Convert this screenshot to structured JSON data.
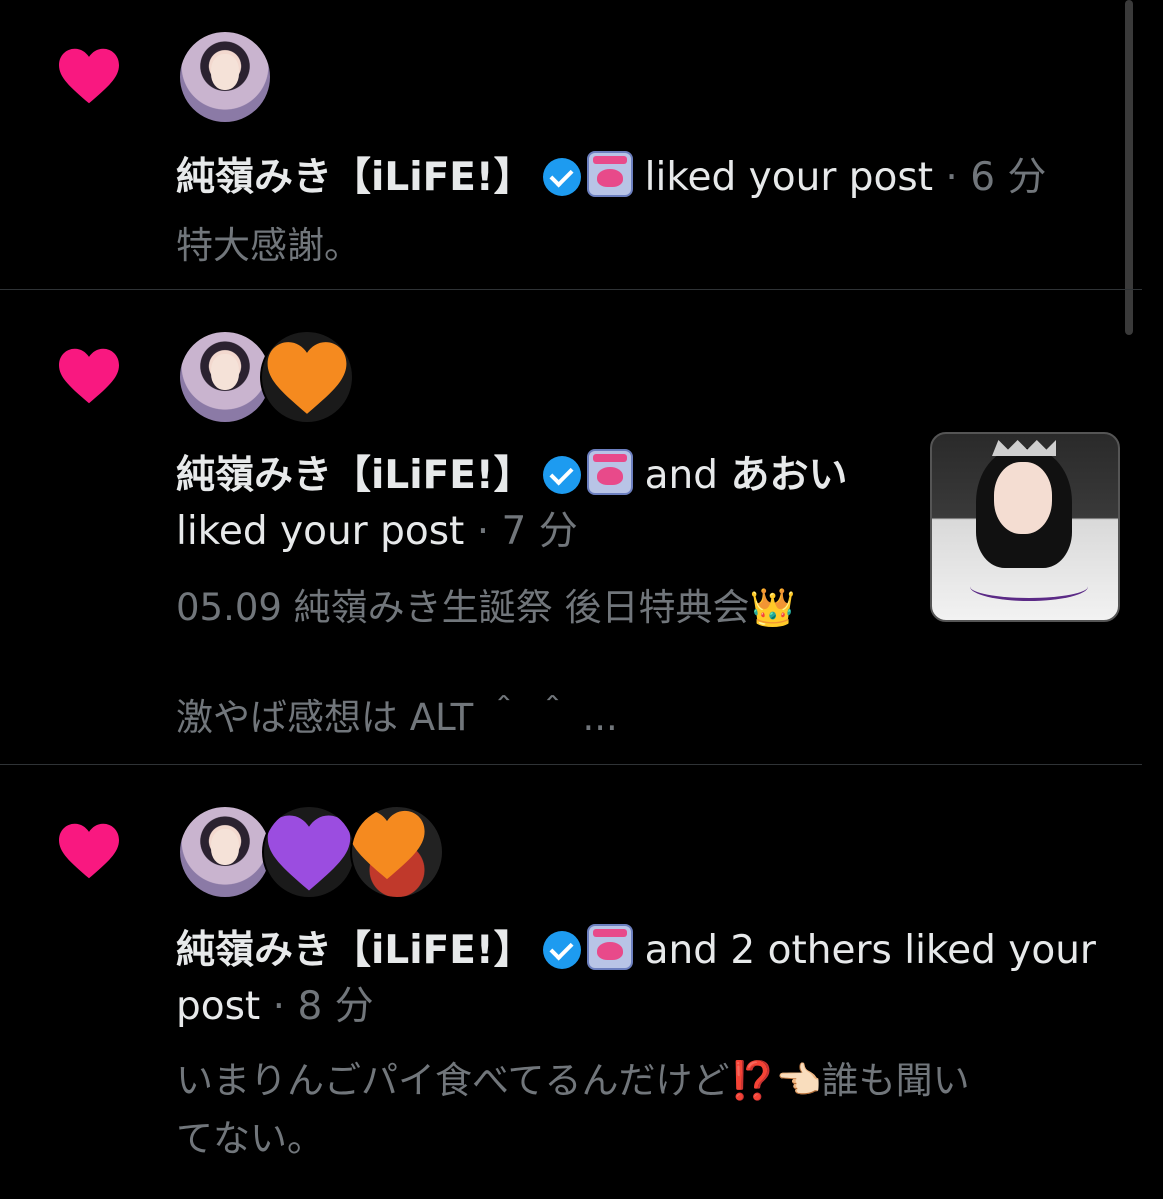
{
  "notifications": [
    {
      "name": "純嶺みき【iLiFE!】",
      "action": "liked your post",
      "time": "6 分",
      "preview": [
        "特大感謝。"
      ]
    },
    {
      "name": "純嶺みき【iLiFE!】",
      "joiner": "and",
      "other_name": "あおい",
      "action": "liked your post",
      "time": "7 分",
      "preview": [
        "05.09 純嶺みき生誕祭 後日特典会👑",
        "激やば感想は ALT ＾ ＾ ..."
      ]
    },
    {
      "name": "純嶺みき【iLiFE!】",
      "action_line1": "and 2 others liked your",
      "action_line2": "post",
      "time": "8 分",
      "preview": [
        "いまりんごパイ食べてるんだけど⁉️👈🏻誰も聞い",
        "てない。"
      ]
    }
  ],
  "icons": {
    "like": "heart-icon",
    "verified": "verified-badge-icon",
    "affiliate": "ilife-logo-icon",
    "reaction_orange": "orange-heart-emoji",
    "reaction_purple": "purple-heart-emoji"
  },
  "colors": {
    "like_heart": "#f91880",
    "verified": "#1d9bf0",
    "muted_text": "#71767b",
    "divider": "#2f3336",
    "orange_heart": "#f58a1f",
    "purple_heart": "#9b4de0"
  }
}
